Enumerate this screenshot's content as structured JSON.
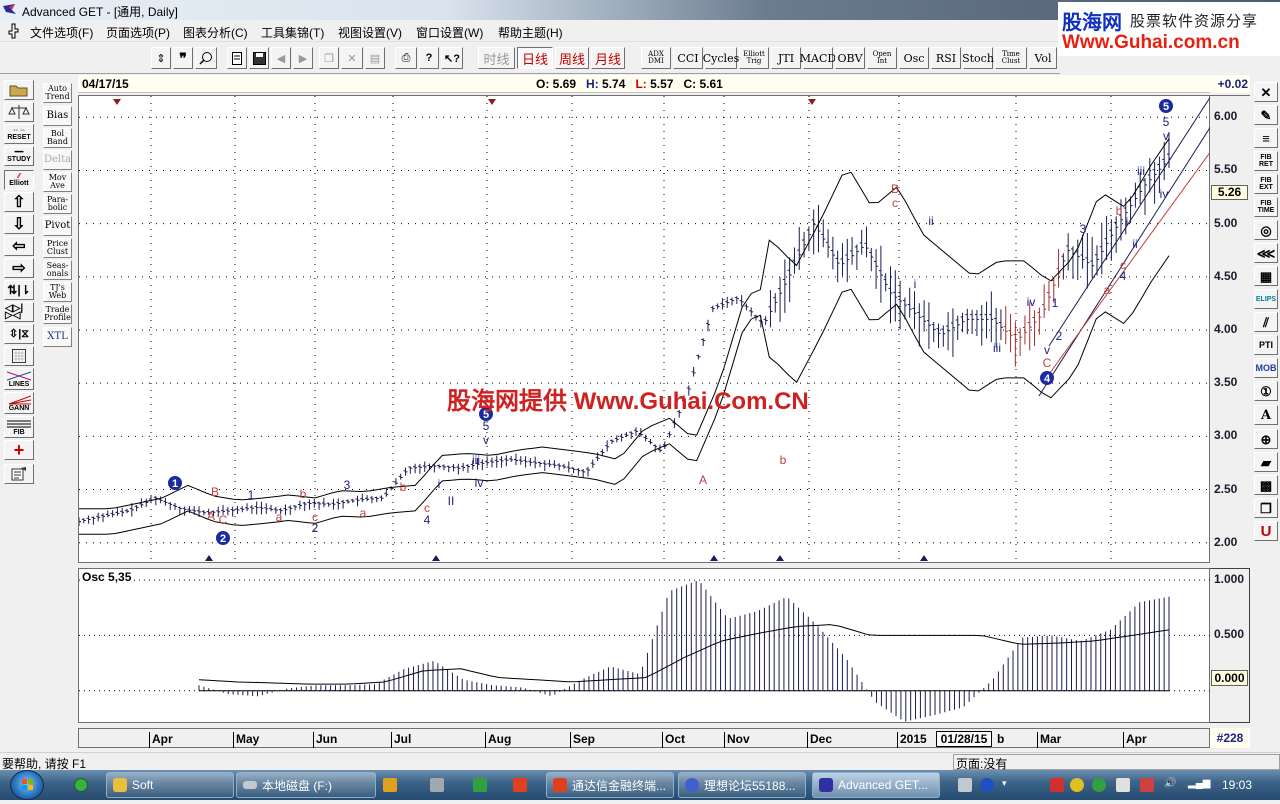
{
  "window": {
    "title": "Advanced GET - [通用, Daily]"
  },
  "menu": [
    "文件选项(F)",
    "页面选项(P)",
    "图表分析(C)",
    "工具集锦(T)",
    "视图设置(V)",
    "窗口设置(W)",
    "帮助主题(H)"
  ],
  "toolbar": {
    "file_icons": [
      "cursor-icon",
      "quote-icon",
      "search-icon",
      "new-doc-icon",
      "save-icon",
      "back-icon",
      "forward-icon",
      "copy-icon",
      "delete-icon",
      "paste-icon",
      "print-icon",
      "help-icon",
      "context-help-icon"
    ],
    "periods": [
      {
        "label": "时线",
        "disabled": true
      },
      {
        "label": "日线",
        "active": true
      },
      {
        "label": "周线"
      },
      {
        "label": "月线"
      }
    ],
    "indicators": [
      {
        "l1": "ADX",
        "l2": "DMI"
      },
      {
        "l1": "CCI",
        "l2": ""
      },
      {
        "l1": "Cycles",
        "l2": ""
      },
      {
        "l1": "Elliott",
        "l2": "Trig"
      },
      {
        "l1": "JTI",
        "l2": ""
      },
      {
        "l1": "MACD",
        "l2": ""
      },
      {
        "l1": "OBV",
        "l2": ""
      },
      {
        "l1": "Open",
        "l2": "Int"
      },
      {
        "l1": "Osc",
        "l2": ""
      },
      {
        "l1": "RSI",
        "l2": ""
      },
      {
        "l1": "Stoch",
        "l2": ""
      },
      {
        "l1": "Time",
        "l2": "Clust"
      },
      {
        "l1": "Vol",
        "l2": ""
      }
    ]
  },
  "brand": {
    "name": "股海网",
    "slogan": "股票软件资源分享",
    "url": "Www.Guhai.com.cn"
  },
  "left_tools": [
    "open",
    "balance",
    "RESET",
    "STUDY",
    "Elliott",
    "up",
    "down",
    "left",
    "right",
    "split",
    "expand",
    "vzoom",
    "grid",
    "LINES",
    "GANN",
    "FIB",
    "crosshair",
    "properties"
  ],
  "study_tools": [
    {
      "l1": "Auto",
      "l2": "Trend"
    },
    {
      "l1": "Bias",
      "l2": ""
    },
    {
      "l1": "Bol",
      "l2": "Band"
    },
    {
      "l1": "Delta",
      "l2": "",
      "disabled": true
    },
    {
      "l1": "Mov",
      "l2": "Ave"
    },
    {
      "l1": "Para-",
      "l2": "bolic"
    },
    {
      "l1": "Pivot",
      "l2": ""
    },
    {
      "l1": "Price",
      "l2": "Clust"
    },
    {
      "l1": "Seas-",
      "l2": "onals"
    },
    {
      "l1": "TJ's",
      "l2": "Web"
    },
    {
      "l1": "Trade",
      "l2": "Profile"
    },
    {
      "l1": "XTL",
      "l2": ""
    }
  ],
  "right_tools": [
    "close",
    "pencil",
    "channel",
    "FIB RET",
    "FIB EXT",
    "FIB TIME",
    "fib-circle",
    "fan",
    "grid",
    "ELIPS",
    "parallel",
    "PTI",
    "MOB",
    "profit-target",
    "text",
    "zoom-in",
    "eraser",
    "pattern",
    "copy",
    "magnet"
  ],
  "info": {
    "date": "04/17/15",
    "open": "O: 5.69",
    "high": "H: 5.74",
    "low": "L: 5.57",
    "close": "C: 5.61",
    "change": "+0.02"
  },
  "price_axis": {
    "ticks": [
      "6.00",
      "5.50",
      "5.00",
      "4.50",
      "4.00",
      "3.50",
      "3.00",
      "2.50",
      "2.00"
    ],
    "current": "5.26"
  },
  "osc": {
    "label": "Osc 5,35",
    "ticks": [
      "1.000",
      "0.500",
      "0.000"
    ]
  },
  "time_axis": {
    "months": [
      "Apr",
      "May",
      "Jun",
      "Jul",
      "Aug",
      "Sep",
      "Oct",
      "Nov",
      "Dec",
      "2015",
      "b",
      "Mar",
      "Apr"
    ],
    "cursor_date": "01/28/15",
    "bar_count": "#228"
  },
  "watermark": "股海网提供 Www.Guhai.Com.CN",
  "wave_labels": {
    "circled": [
      "1",
      "2",
      "5",
      "4",
      "5"
    ],
    "labels": [
      "A",
      "B",
      "C",
      "a",
      "b",
      "c",
      "1",
      "2",
      "3",
      "4",
      "5",
      "i",
      "ii",
      "iii",
      "iv",
      "v"
    ]
  },
  "chart_data": {
    "type": "ohlc",
    "title": "Advanced GET Daily",
    "ylim": [
      1.8,
      6.2
    ],
    "osc_ylim": [
      -0.3,
      1.1
    ],
    "months": [
      "Apr",
      "May",
      "Jun",
      "Jul",
      "Aug",
      "Sep",
      "Oct",
      "Nov",
      "Dec",
      "2015",
      "Feb",
      "Mar",
      "Apr"
    ],
    "close_approx": [
      2.2,
      2.25,
      2.3,
      2.42,
      2.32,
      2.28,
      2.3,
      2.33,
      2.3,
      2.37,
      2.36,
      2.4,
      2.42,
      2.7,
      2.72,
      2.7,
      2.75,
      2.78,
      2.75,
      2.72,
      2.66,
      2.95,
      3.05,
      2.85,
      3.4,
      4.2,
      4.3,
      4.05,
      4.5,
      5.0,
      4.6,
      4.8,
      4.35,
      4.15,
      3.95,
      4.1,
      4.1,
      3.9,
      4.15,
      4.75,
      4.6,
      5.0,
      5.35,
      5.61
    ],
    "osc_approx": [
      0.05,
      -0.03,
      -0.05,
      0.02,
      0.05,
      0.05,
      0.06,
      0.2,
      0.27,
      0.1,
      0.05,
      0.03,
      -0.05,
      0.1,
      0.22,
      0.15,
      0.9,
      1.0,
      0.65,
      0.72,
      0.85,
      0.6,
      0.3,
      -0.1,
      -0.28,
      -0.22,
      -0.15,
      0.1,
      0.48,
      0.5,
      0.45,
      0.55,
      0.8,
      0.85
    ],
    "osc_signal_approx": [
      0.1,
      0.08,
      0.07,
      0.06,
      0.06,
      0.08,
      0.18,
      0.2,
      0.12,
      0.1,
      0.08,
      0.1,
      0.12,
      0.3,
      0.45,
      0.52,
      0.58,
      0.6,
      0.5,
      0.5,
      0.5,
      0.5,
      0.42,
      0.43,
      0.45,
      0.5,
      0.55
    ]
  },
  "status": {
    "help": "要帮助, 请按 F1",
    "page": "页面:没有"
  },
  "taskbar": {
    "items": [
      "Soft",
      "本地磁盘 (F:)",
      "通达信金融终端...",
      "理想论坛55188...",
      "Advanced GET..."
    ],
    "clock": "19:03"
  }
}
